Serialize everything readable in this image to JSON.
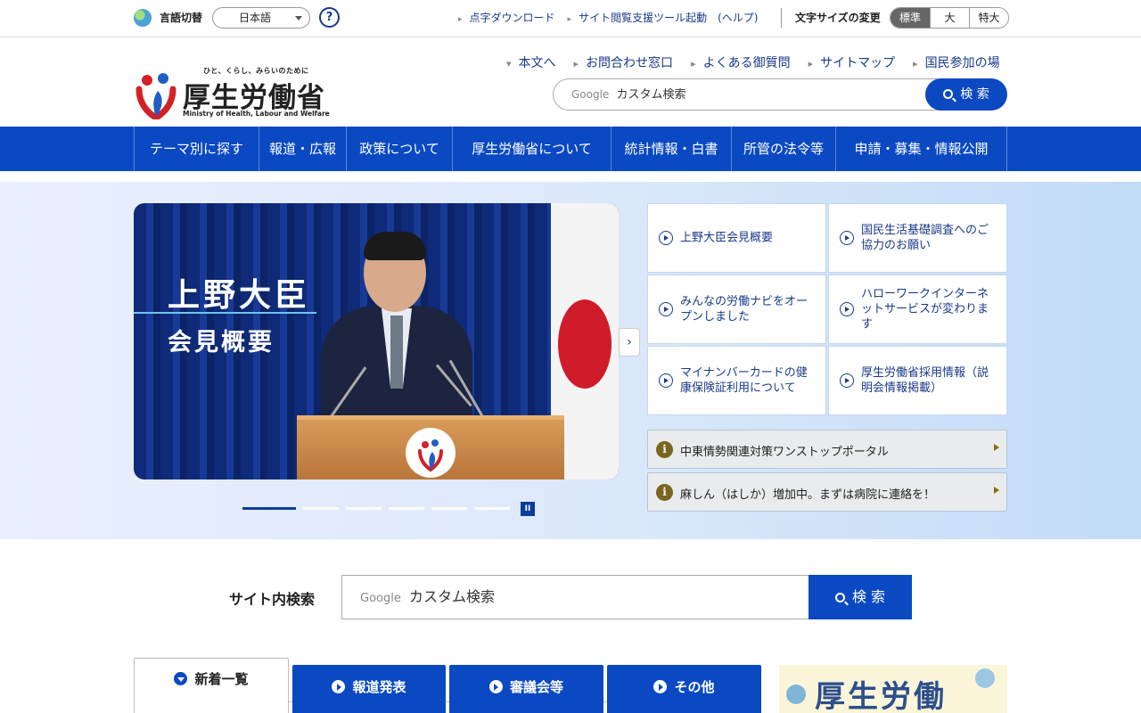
{
  "utility": {
    "lang_label": "言語切替",
    "lang_value": "日本語",
    "help_glyph": "?",
    "links": [
      "点字ダウンロード",
      "サイト閲覧支援ツール起動　(ヘルプ)"
    ],
    "fontsize_label": "文字サイズの変更",
    "fontsizes": [
      "標準",
      "大",
      "特大"
    ]
  },
  "header": {
    "logo_tagline": "ひと、くらし、みらいのために",
    "logo_title": "厚生労働省",
    "logo_en": "Ministry of Health, Labour and Welfare",
    "links": [
      "本文へ",
      "お問合わせ窓口",
      "よくある御質問",
      "サイトマップ",
      "国民参加の場"
    ],
    "search_brand": "Google",
    "search_placeholder": "カスタム検索",
    "search_button": "検 索"
  },
  "nav": {
    "items": [
      "テーマ別に探す",
      "報道・広報",
      "政策について",
      "厚生労働省について",
      "統計情報・白書",
      "所管の法令等",
      "申請・募集・情報公開"
    ]
  },
  "hero": {
    "slide_title_line1": "上野大臣",
    "slide_title_line2": "会見概要",
    "next_glyph": "›",
    "pause_glyph": "II",
    "cards": [
      "上野大臣会見概要",
      "国民生活基礎調査へのご協力のお願い",
      "みんなの労働ナビをオープンしました",
      "ハローワークインターネットサービスが変わります",
      "マイナンバーカードの健康保険証利用について",
      "厚生労働省採用情報（説明会情報掲載）"
    ],
    "alert_glyph": "i",
    "alerts": [
      "中東情勢関連対策ワンストップポータル",
      "麻しん（はしか）増加中。まずは病院に連絡を！"
    ]
  },
  "site_search": {
    "label": "サイト内検索",
    "brand": "Google",
    "placeholder": "カスタム検索",
    "button": "検 索"
  },
  "tabs": [
    "新着一覧",
    "報道発表",
    "審議会等",
    "その他"
  ],
  "banner": {
    "text": "厚生労働"
  },
  "colors": {
    "primary_blue": "#0a49c2",
    "link_blue": "#1a3a8a",
    "alert_icon": "#7a6420"
  },
  "icons": [
    "globe-icon",
    "help-icon",
    "search-icon",
    "play-circle-icon",
    "info-icon",
    "chevron-right-icon",
    "pause-icon"
  ]
}
